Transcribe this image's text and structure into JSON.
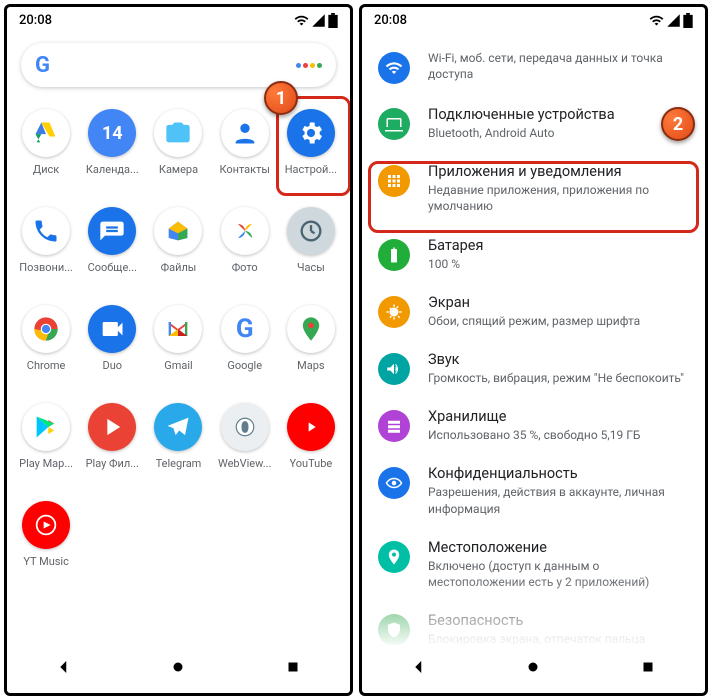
{
  "status": {
    "time": "20:08"
  },
  "step1": "1",
  "step2": "2",
  "apps": [
    {
      "label": "Диск"
    },
    {
      "label": "Календа..."
    },
    {
      "label": "Камера"
    },
    {
      "label": "Контакты"
    },
    {
      "label": "Настрой..."
    },
    {
      "label": "Позвони..."
    },
    {
      "label": "Сообще..."
    },
    {
      "label": "Файлы"
    },
    {
      "label": "Фото"
    },
    {
      "label": "Часы"
    },
    {
      "label": "Chrome"
    },
    {
      "label": "Duo"
    },
    {
      "label": "Gmail"
    },
    {
      "label": "Google"
    },
    {
      "label": "Maps"
    },
    {
      "label": "Play Мар..."
    },
    {
      "label": "Play Фил..."
    },
    {
      "label": "Telegram"
    },
    {
      "label": "WebView..."
    },
    {
      "label": "YouTube"
    },
    {
      "label": "YT Music"
    }
  ],
  "settings": [
    {
      "title": "",
      "sub": "Wi-Fi, моб. сети, передача данных и точка доступа",
      "color": "#1a73e8",
      "icon": "wifi"
    },
    {
      "title": "Подключенные устройства",
      "sub": "Bluetooth, Android Auto",
      "color": "#1eab62",
      "icon": "devices"
    },
    {
      "title": "Приложения и уведомления",
      "sub": "Недавние приложения, приложения по умолчанию",
      "color": "#f29900",
      "icon": "apps"
    },
    {
      "title": "Батарея",
      "sub": "100 %",
      "color": "#20ad3a",
      "icon": "battery"
    },
    {
      "title": "Экран",
      "sub": "Обои, спящий режим, размер шрифта",
      "color": "#f29900",
      "icon": "brightness"
    },
    {
      "title": "Звук",
      "sub": "Громкость, вибрация, режим \"Не беспокоить\"",
      "color": "#00a5a3",
      "icon": "volume"
    },
    {
      "title": "Хранилище",
      "sub": "Использовано 35 %, свободно 5,19 ГБ",
      "color": "#b142d6",
      "icon": "storage"
    },
    {
      "title": "Конфиденциальность",
      "sub": "Разрешения, действия в аккаунте, личная информация",
      "color": "#1a73e8",
      "icon": "privacy"
    },
    {
      "title": "Местоположение",
      "sub": "Включено (доступ к данным о местоположении есть у 2 приложений)",
      "color": "#00bfa5",
      "icon": "location"
    },
    {
      "title": "Безопасность",
      "sub": "Блокировка экрана, отпечаток пальца",
      "color": "#34a853",
      "icon": "security"
    }
  ]
}
